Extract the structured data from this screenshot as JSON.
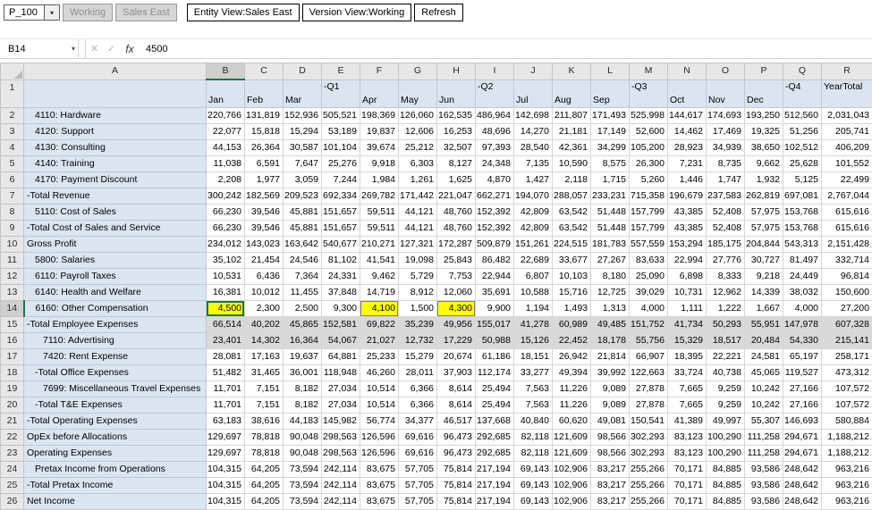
{
  "icons": {
    "dropdown": "▾",
    "cancel": "✕",
    "enter": "✓",
    "fx": "fx"
  },
  "pov_toolbar": {
    "page_selector_value": "P_100",
    "working_label": "Working",
    "sales_east_label": "Sales East",
    "entity_view_label": "Entity View:Sales East",
    "version_view_label": "Version View:Working",
    "refresh_label": "Refresh"
  },
  "formula_bar": {
    "name_box": "B14",
    "value": "4500"
  },
  "grid": {
    "active_cell": "B14",
    "active_column": "B",
    "active_row": 14,
    "colors": {
      "header_fill": "#dbe5f1",
      "dirty_cell": "#ffff00",
      "shaded_row": "#d9d9d9",
      "selection_accent": "#217346"
    },
    "column_letters": [
      "A",
      "B",
      "C",
      "D",
      "E",
      "F",
      "G",
      "H",
      "I",
      "J",
      "K",
      "L",
      "M",
      "N",
      "O",
      "P",
      "Q",
      "R"
    ],
    "month_header": {
      "n": 1,
      "top": [
        "",
        "",
        "",
        "-Q1",
        "",
        "",
        "",
        "-Q2",
        "",
        "",
        "",
        "-Q3",
        "",
        "",
        "",
        "-Q4",
        "YearTotal"
      ],
      "bottom": [
        "Jan",
        "Feb",
        "Mar",
        "",
        "Apr",
        "May",
        "Jun",
        "",
        "Jul",
        "Aug",
        "Sep",
        "",
        "Oct",
        "Nov",
        "Dec",
        "",
        ""
      ]
    },
    "rows": [
      {
        "n": 2,
        "label": "4110: Hardware",
        "indent": 1,
        "cells": [
          "220,766",
          "131,819",
          "152,936",
          "505,521",
          "198,369",
          "126,060",
          "162,535",
          "486,964",
          "142,698",
          "211,807",
          "171,493",
          "525,998",
          "144,617",
          "174,693",
          "193,250",
          "512,560",
          "2,031,043"
        ]
      },
      {
        "n": 3,
        "label": "4120: Support",
        "indent": 1,
        "cells": [
          "22,077",
          "15,818",
          "15,294",
          "53,189",
          "19,837",
          "12,606",
          "16,253",
          "48,696",
          "14,270",
          "21,181",
          "17,149",
          "52,600",
          "14,462",
          "17,469",
          "19,325",
          "51,256",
          "205,741"
        ]
      },
      {
        "n": 4,
        "label": "4130: Consulting",
        "indent": 1,
        "cells": [
          "44,153",
          "26,364",
          "30,587",
          "101,104",
          "39,674",
          "25,212",
          "32,507",
          "97,393",
          "28,540",
          "42,361",
          "34,299",
          "105,200",
          "28,923",
          "34,939",
          "38,650",
          "102,512",
          "406,209"
        ]
      },
      {
        "n": 5,
        "label": "4140: Training",
        "indent": 1,
        "cells": [
          "11,038",
          "6,591",
          "7,647",
          "25,276",
          "9,918",
          "6,303",
          "8,127",
          "24,348",
          "7,135",
          "10,590",
          "8,575",
          "26,300",
          "7,231",
          "8,735",
          "9,662",
          "25,628",
          "101,552"
        ]
      },
      {
        "n": 6,
        "label": "4170: Payment Discount",
        "indent": 1,
        "cells": [
          "2,208",
          "1,977",
          "3,059",
          "7,244",
          "1,984",
          "1,261",
          "1,625",
          "4,870",
          "1,427",
          "2,118",
          "1,715",
          "5,260",
          "1,446",
          "1,747",
          "1,932",
          "5,125",
          "22,499"
        ]
      },
      {
        "n": 7,
        "label": "-Total Revenue",
        "indent": 0,
        "cells": [
          "300,242",
          "182,569",
          "209,523",
          "692,334",
          "269,782",
          "171,442",
          "221,047",
          "662,271",
          "194,070",
          "288,057",
          "233,231",
          "715,358",
          "196,679",
          "237,583",
          "262,819",
          "697,081",
          "2,767,044"
        ]
      },
      {
        "n": 8,
        "label": "5110: Cost of Sales",
        "indent": 1,
        "cells": [
          "66,230",
          "39,546",
          "45,881",
          "151,657",
          "59,511",
          "44,121",
          "48,760",
          "152,392",
          "42,809",
          "63,542",
          "51,448",
          "157,799",
          "43,385",
          "52,408",
          "57,975",
          "153,768",
          "615,616"
        ]
      },
      {
        "n": 9,
        "label": "-Total Cost of Sales and Service",
        "indent": 0,
        "cells": [
          "66,230",
          "39,546",
          "45,881",
          "151,657",
          "59,511",
          "44,121",
          "48,760",
          "152,392",
          "42,809",
          "63,542",
          "51,448",
          "157,799",
          "43,385",
          "52,408",
          "57,975",
          "153,768",
          "615,616"
        ]
      },
      {
        "n": 10,
        "label": "Gross Profit",
        "indent": 0,
        "cells": [
          "234,012",
          "143,023",
          "163,642",
          "540,677",
          "210,271",
          "127,321",
          "172,287",
          "509,879",
          "151,261",
          "224,515",
          "181,783",
          "557,559",
          "153,294",
          "185,175",
          "204,844",
          "543,313",
          "2,151,428"
        ]
      },
      {
        "n": 11,
        "label": "5800: Salaries",
        "indent": 1,
        "cells": [
          "35,102",
          "21,454",
          "24,546",
          "81,102",
          "41,541",
          "19,098",
          "25,843",
          "86,482",
          "22,689",
          "33,677",
          "27,267",
          "83,633",
          "22,994",
          "27,776",
          "30,727",
          "81,497",
          "332,714"
        ]
      },
      {
        "n": 12,
        "label": "6110: Payroll Taxes",
        "indent": 1,
        "cells": [
          "10,531",
          "6,436",
          "7,364",
          "24,331",
          "9,462",
          "5,729",
          "7,753",
          "22,944",
          "6,807",
          "10,103",
          "8,180",
          "25,090",
          "6,898",
          "8,333",
          "9,218",
          "24,449",
          "96,814"
        ]
      },
      {
        "n": 13,
        "label": "6140: Health and Welfare",
        "indent": 1,
        "cells": [
          "16,381",
          "10,012",
          "11,455",
          "37,848",
          "14,719",
          "8,912",
          "12,060",
          "35,691",
          "10,588",
          "15,716",
          "12,725",
          "39,029",
          "10,731",
          "12,962",
          "14,339",
          "38,032",
          "150,600"
        ]
      },
      {
        "n": 14,
        "label": "6160: Other Compensation",
        "indent": 1,
        "active_cell_index": 0,
        "dirty": [
          0,
          4,
          6
        ],
        "cells": [
          "4,500",
          "2,300",
          "2,500",
          "9,300",
          "4,100",
          "1,500",
          "4,300",
          "9,900",
          "1,194",
          "1,493",
          "1,313",
          "4,000",
          "1,111",
          "1,222",
          "1,667",
          "4,000",
          "27,200"
        ]
      },
      {
        "n": 15,
        "label": "-Total Employee Expenses",
        "indent": 0,
        "shaded": true,
        "cells": [
          "66,514",
          "40,202",
          "45,865",
          "152,581",
          "69,822",
          "35,239",
          "49,956",
          "155,017",
          "41,278",
          "60,989",
          "49,485",
          "151,752",
          "41,734",
          "50,293",
          "55,951",
          "147,978",
          "607,328"
        ]
      },
      {
        "n": 16,
        "label": "7110: Advertising",
        "indent": 2,
        "shaded": true,
        "cells": [
          "23,401",
          "14,302",
          "16,364",
          "54,067",
          "21,027",
          "12,732",
          "17,229",
          "50,988",
          "15,126",
          "22,452",
          "18,178",
          "55,756",
          "15,329",
          "18,517",
          "20,484",
          "54,330",
          "215,141"
        ]
      },
      {
        "n": 17,
        "label": "7420: Rent Expense",
        "indent": 2,
        "cells": [
          "28,081",
          "17,163",
          "19,637",
          "64,881",
          "25,233",
          "15,279",
          "20,674",
          "61,186",
          "18,151",
          "26,942",
          "21,814",
          "66,907",
          "18,395",
          "22,221",
          "24,581",
          "65,197",
          "258,171"
        ]
      },
      {
        "n": 18,
        "label": "-Total Office Expenses",
        "indent": 1,
        "cells": [
          "51,482",
          "31,465",
          "36,001",
          "118,948",
          "46,260",
          "28,011",
          "37,903",
          "112,174",
          "33,277",
          "49,394",
          "39,992",
          "122,663",
          "33,724",
          "40,738",
          "45,065",
          "119,527",
          "473,312"
        ]
      },
      {
        "n": 19,
        "label": "7699: Miscellaneous Travel Expenses",
        "indent": 2,
        "cells": [
          "11,701",
          "7,151",
          "8,182",
          "27,034",
          "10,514",
          "6,366",
          "8,614",
          "25,494",
          "7,563",
          "11,226",
          "9,089",
          "27,878",
          "7,665",
          "9,259",
          "10,242",
          "27,166",
          "107,572"
        ]
      },
      {
        "n": 20,
        "label": "-Total T&E Expenses",
        "indent": 1,
        "cells": [
          "11,701",
          "7,151",
          "8,182",
          "27,034",
          "10,514",
          "6,366",
          "8,614",
          "25,494",
          "7,563",
          "11,226",
          "9,089",
          "27,878",
          "7,665",
          "9,259",
          "10,242",
          "27,166",
          "107,572"
        ]
      },
      {
        "n": 21,
        "label": "-Total Operating Expenses",
        "indent": 0,
        "cells": [
          "63,183",
          "38,616",
          "44,183",
          "145,982",
          "56,774",
          "34,377",
          "46,517",
          "137,668",
          "40,840",
          "60,620",
          "49,081",
          "150,541",
          "41,389",
          "49,997",
          "55,307",
          "146,693",
          "580,884"
        ]
      },
      {
        "n": 22,
        "label": "OpEx before Allocations",
        "indent": 0,
        "cells": [
          "129,697",
          "78,818",
          "90,048",
          "298,563",
          "126,596",
          "69,616",
          "96,473",
          "292,685",
          "82,118",
          "121,609",
          "98,566",
          "302,293",
          "83,123",
          "100,290",
          "111,258",
          "294,671",
          "1,188,212"
        ]
      },
      {
        "n": 23,
        "label": "Operating Expenses",
        "indent": 0,
        "cells": [
          "129,697",
          "78,818",
          "90,048",
          "298,563",
          "126,596",
          "69,616",
          "96,473",
          "292,685",
          "82,118",
          "121,609",
          "98,566",
          "302,293",
          "83,123",
          "100,290",
          "111,258",
          "294,671",
          "1,188,212"
        ]
      },
      {
        "n": 24,
        "label": "Pretax Income from Operations",
        "indent": 1,
        "cells": [
          "104,315",
          "64,205",
          "73,594",
          "242,114",
          "83,675",
          "57,705",
          "75,814",
          "217,194",
          "69,143",
          "102,906",
          "83,217",
          "255,266",
          "70,171",
          "84,885",
          "93,586",
          "248,642",
          "963,216"
        ]
      },
      {
        "n": 25,
        "label": "-Total Pretax Income",
        "indent": 0,
        "cells": [
          "104,315",
          "64,205",
          "73,594",
          "242,114",
          "83,675",
          "57,705",
          "75,814",
          "217,194",
          "69,143",
          "102,906",
          "83,217",
          "255,266",
          "70,171",
          "84,885",
          "93,586",
          "248,642",
          "963,216"
        ]
      },
      {
        "n": 26,
        "label": "Net Income",
        "indent": 0,
        "cells": [
          "104,315",
          "64,205",
          "73,594",
          "242,114",
          "83,675",
          "57,705",
          "75,814",
          "217,194",
          "69,143",
          "102,906",
          "83,217",
          "255,266",
          "70,171",
          "84,885",
          "93,586",
          "248,642",
          "963,216"
        ]
      }
    ]
  }
}
